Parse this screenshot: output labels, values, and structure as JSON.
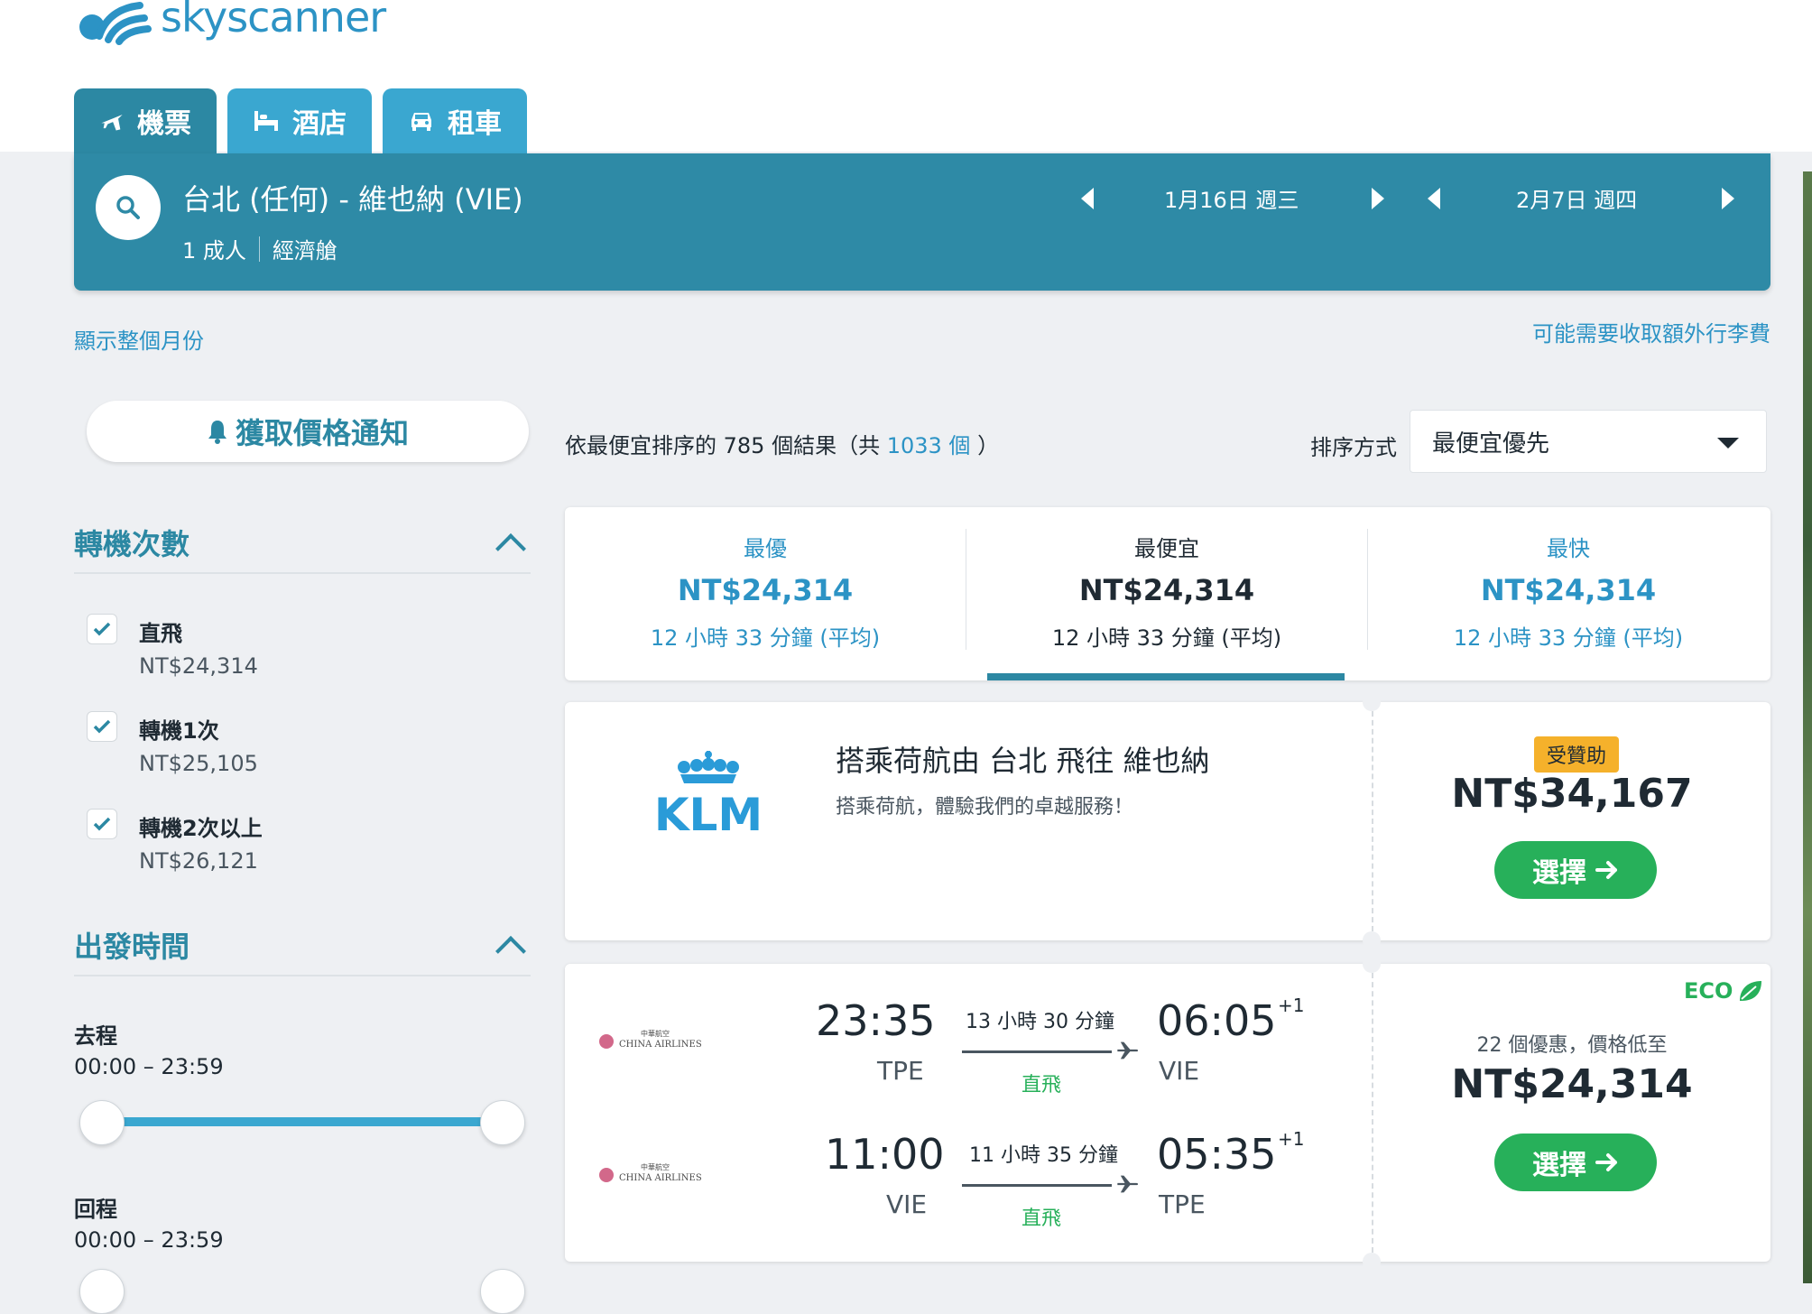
{
  "brand": {
    "name": "skyscanner"
  },
  "tabs": [
    {
      "label": "機票",
      "icon": "plane-icon",
      "active": true
    },
    {
      "label": "酒店",
      "icon": "bed-icon",
      "active": false
    },
    {
      "label": "租車",
      "icon": "car-icon",
      "active": false
    }
  ],
  "search": {
    "route": "台北 (任何) - 維也納 (VIE)",
    "passengers": "1 成人",
    "cabin": "經濟艙",
    "depart_date": "1月16日 週三",
    "return_date": "2月7日 週四"
  },
  "links": {
    "show_month": "顯示整個月份",
    "baggage_fee": "可能需要收取額外行李費"
  },
  "price_alert": {
    "label": "獲取價格通知"
  },
  "results": {
    "summary_prefix": "依最便宜排序的 785 個結果（共",
    "total_link": "1033 個",
    "summary_suffix": "）"
  },
  "sort": {
    "label": "排序方式",
    "value": "最便宜優先"
  },
  "filters": {
    "stops": {
      "title": "轉機次數",
      "options": [
        {
          "label": "直飛",
          "price": "NT$24,314",
          "checked": true
        },
        {
          "label": "轉機1次",
          "price": "NT$25,105",
          "checked": true
        },
        {
          "label": "轉機2次以上",
          "price": "NT$26,121",
          "checked": true
        }
      ]
    },
    "times": {
      "title": "出發時間",
      "outbound_label": "去程",
      "outbound_range": "00:00 – 23:59",
      "return_label": "回程",
      "return_range": "00:00 – 23:59"
    }
  },
  "summary_tabs": [
    {
      "title": "最優",
      "price": "NT$24,314",
      "duration": "12 小時 33 分鐘 (平均)"
    },
    {
      "title": "最便宜",
      "price": "NT$24,314",
      "duration": "12 小時 33 分鐘 (平均)",
      "active": true
    },
    {
      "title": "最快",
      "price": "NT$24,314",
      "duration": "12 小時 33 分鐘 (平均)"
    }
  ],
  "ad": {
    "logo": "KLM",
    "title": "搭乘荷航由 台北 飛往 維也納",
    "subtitle": "搭乘荷航，體驗我們的卓越服務！",
    "badge": "受贊助",
    "price": "NT$34,167",
    "button": "選擇"
  },
  "flight": {
    "eco": "ECO",
    "deals": "22 個優惠，價格低至",
    "price": "NT$24,314",
    "button": "選擇",
    "airline": "CHINA AIRLINES",
    "outbound": {
      "depart_time": "23:35",
      "depart_code": "TPE",
      "duration": "13 小時 30 分鐘",
      "stops": "直飛",
      "arrive_time": "06:05",
      "arrive_code": "VIE",
      "plus_day": "+1"
    },
    "inbound": {
      "depart_time": "11:00",
      "depart_code": "VIE",
      "duration": "11 小時 35 分鐘",
      "stops": "直飛",
      "arrive_time": "05:35",
      "arrive_code": "TPE",
      "plus_day": "+1"
    }
  },
  "colors": {
    "primary": "#2c88a3",
    "accent": "#3aa7d0",
    "green": "#27b05a",
    "sponsor": "#f5b12b"
  }
}
